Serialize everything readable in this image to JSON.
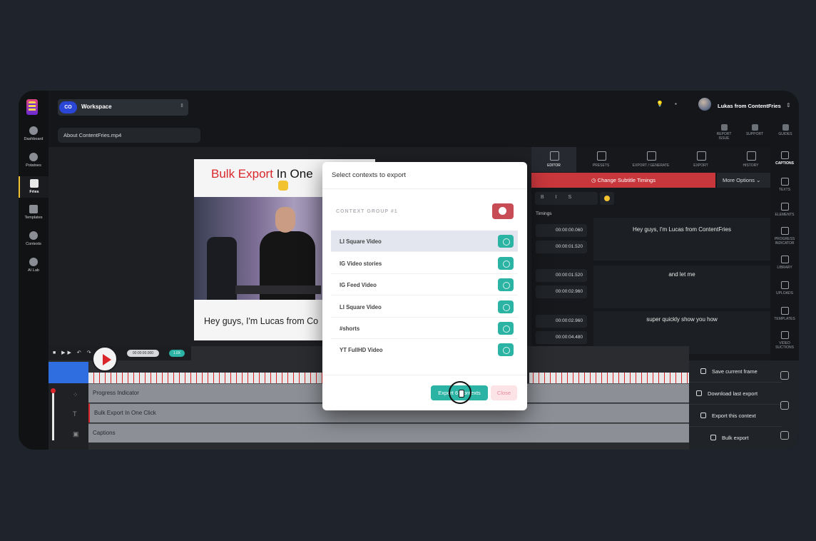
{
  "workspace": {
    "avatar": "CO",
    "name": "Workspace"
  },
  "user": {
    "name": "Lukas from ContentFries"
  },
  "file": {
    "name": "About ContentFries.mp4"
  },
  "sidebar": {
    "items": [
      {
        "label": "Dashboard",
        "icon": "dashboard-icon"
      },
      {
        "label": "Potatoes",
        "icon": "potato-icon"
      },
      {
        "label": "Fries",
        "icon": "fries-icon"
      },
      {
        "label": "Templates",
        "icon": "layers-icon"
      },
      {
        "label": "Contexts",
        "icon": "network-icon"
      },
      {
        "label": "AI Lab",
        "icon": "gear-icon"
      }
    ]
  },
  "top_actions": {
    "report": "REPORT ISSUE",
    "support": "SUPPORT",
    "guides": "GUIDES"
  },
  "preview": {
    "title_red": "Bulk Export",
    "title_rest": " In One",
    "caption": "Hey guys, I'm Lucas from Co"
  },
  "editor_tabs": [
    "EDITOR",
    "PRESETS",
    "EXPORT / GENERATE",
    "EXPORT",
    "HISTORY",
    "CAPTIONS"
  ],
  "subtitle_bar": {
    "label": "Change Subtitle Timings",
    "more": "More Options"
  },
  "format": "B I S",
  "timings_label": "Timings",
  "subtitles": [
    {
      "start": "00:00:00.060",
      "end": "00:00:01.520",
      "text": "Hey guys, I'm Lucas from ContentFries"
    },
    {
      "start": "00:00:01.520",
      "end": "00:00:02.960",
      "text": "and let me"
    },
    {
      "start": "00:00:02.960",
      "end": "00:00:04.480",
      "text": "super quickly show you how"
    }
  ],
  "right_sidebar": [
    "TEXTS",
    "ELEMENTS",
    "PROGRESS INDICATOR",
    "LIBRARY",
    "UPLOADS",
    "TEMPLATES",
    "VIDEO SUCTIONS"
  ],
  "timeline": {
    "controls": "■ ▶▶ ↶ ↷",
    "timecode": "00:00:00.000",
    "speed": "1.0X",
    "tracks": [
      "Progress Indicator",
      "Bulk Export In One Click",
      "Captions"
    ]
  },
  "actions": [
    "Save current frame",
    "Download last export",
    "Export this context",
    "Bulk export"
  ],
  "modal": {
    "title": "Select contexts to export",
    "group": "CONTEXT GROUP #1",
    "rows": [
      "LI Square Video",
      "IG Video stories",
      "IG Feed Video",
      "LI Square Video",
      "#shorts",
      "YT FullHD Video"
    ],
    "export_label": "Export 6 Contexts",
    "close_label": "Close"
  },
  "colors": {
    "accent": "#2bb3a3",
    "brand_red": "#d9262b",
    "blue": "#2f6ee0",
    "close_pink": "#fbe3e6"
  }
}
